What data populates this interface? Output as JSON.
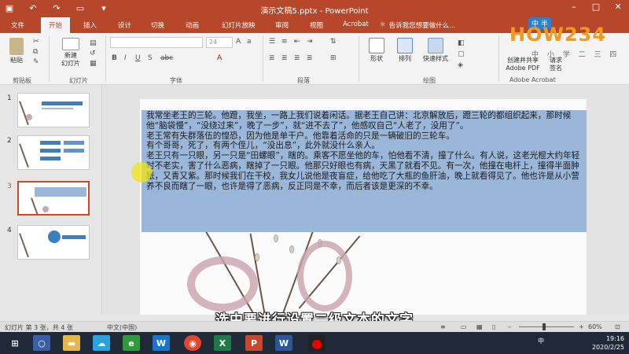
{
  "titlebar": {
    "title": "演示文稿5.pptx - PowerPoint",
    "qa_icons": [
      "save-icon",
      "undo-icon",
      "redo-icon",
      "present-icon",
      "customize-icon"
    ],
    "win_buttons": [
      "minimize-icon",
      "maximize-icon",
      "close-icon"
    ]
  },
  "tabs": [
    "文件",
    "开始",
    "插入",
    "设计",
    "切换",
    "动画",
    "幻灯片放映",
    "审阅",
    "视图",
    "Acrobat"
  ],
  "active_tab": "开始",
  "tellme": "告诉我您想要做什么...",
  "ribbon": {
    "paste": "粘贴",
    "new_slide_line1": "新建",
    "new_slide_line2": "幻灯片",
    "font_size": "24",
    "shape": "形状",
    "arrange": "排列",
    "quick_style": "快速样式",
    "create_pdf_line1": "创建并共享",
    "create_pdf_line2": "Adobe PDF",
    "request_line1": "请求",
    "request_line2": "签名",
    "groups": [
      "剪贴板",
      "幻灯片",
      "字体",
      "段落",
      "绘图",
      "Adobe Acrobat"
    ]
  },
  "logo": {
    "text": "HOW234",
    "sub": "中 小 学 二 三 四",
    "badge": "中 半"
  },
  "thumbs": [
    {
      "num": "1"
    },
    {
      "num": "2"
    },
    {
      "num": "3"
    },
    {
      "num": "4"
    }
  ],
  "slide_text": [
    "我常坐老王的三轮。他蹬，我坐，一路上我们说着闲话。据老王自己讲：北京解放后，蹬三轮的都组织起来，那时候他“脑袋慢”，“没绕过来”，晚了一步”，就“进不去了”，他感叹自己“人老了，没用了”。",
    "老王常有失群落伍的惶恐，因为他是单干户。他靠着活命的只是一辆破旧的三轮车。",
    "有个哥哥，死了，有两个侄儿，“没出息”，此外就没什么亲人。",
    "老王只有一只眼，另一只是“田螺眼”，瞎的。乘客不愿坐他的车，怕他看不清，撞了什么。有人说，这老光棍大约年轻时不老实，害了什么恶病，瞎掉了一只眼。他那只好眼也有病，天黑了就看不见。有一次，他撞在电杆上，撞得半面肿胀，又青又紫。那时候我们在干校，我女儿说他是夜盲症，给他吃了大瓶的鱼肝油，晚上就看得见了。他也许是从小营养不良而瞎了一眼，也许是得了恶病，反正同是不幸，而后者该是更深的不幸。"
  ],
  "subtitle": "选中要进行设置二级文本的文字",
  "status": {
    "slide_info": "幻灯片 第 3 张，共 4 张",
    "language": "中文(中国)",
    "zoom": "60%"
  },
  "taskbar": {
    "ime": "中",
    "time": "19:16",
    "date": "2020/2/25"
  },
  "colors": {
    "brand": "#b7472a",
    "selection": "#9ab6d9",
    "active_thumb_border": "#d24726"
  }
}
